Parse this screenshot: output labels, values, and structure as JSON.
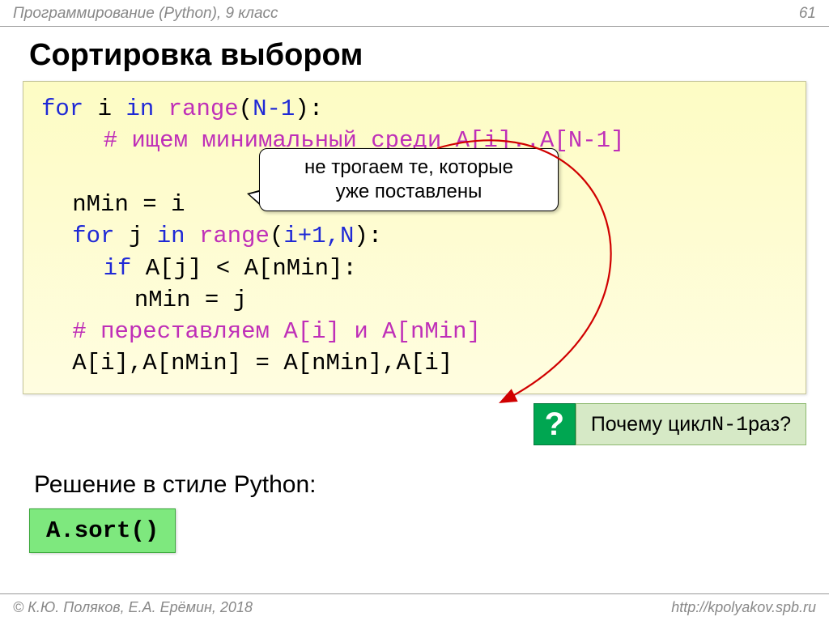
{
  "header": {
    "left": "Программирование (Python), 9 класс",
    "page": "61"
  },
  "title": "Сортировка выбором",
  "code": {
    "l1_for": "for",
    "l1_i": " i ",
    "l1_in": "in",
    "l1_sp": " ",
    "l1_range": "range",
    "l1_open": "(",
    "l1_arg": "N-1",
    "l1_close": "):",
    "l2": "# ищем минимальный среди A[i]..A[N-1]",
    "l3": "nMin = i",
    "l4_for": "for",
    "l4_j": " j ",
    "l4_in": "in",
    "l4_sp": " ",
    "l4_range": "range",
    "l4_open": "(",
    "l4_arg": "i+1,N",
    "l4_close": "):",
    "l5_if": "if",
    "l5_rest": " A[j] < A[nMin]:",
    "l6": "nMin = j",
    "l7": "# переставляем A[i] и A[nMin]",
    "l8": "A[i],A[nMin] = A[nMin],A[i]"
  },
  "callout": {
    "line1": "не трогаем те, которые",
    "line2": "уже поставлены"
  },
  "question": {
    "pre": "Почему цикл ",
    "mono": "N-1",
    "post": " раз?"
  },
  "subtitle": "Решение в стиле Python:",
  "sort": "A.sort()",
  "footer": {
    "left": "© К.Ю. Поляков, Е.А. Ерёмин, 2018",
    "right": "http://kpolyakov.spb.ru"
  }
}
